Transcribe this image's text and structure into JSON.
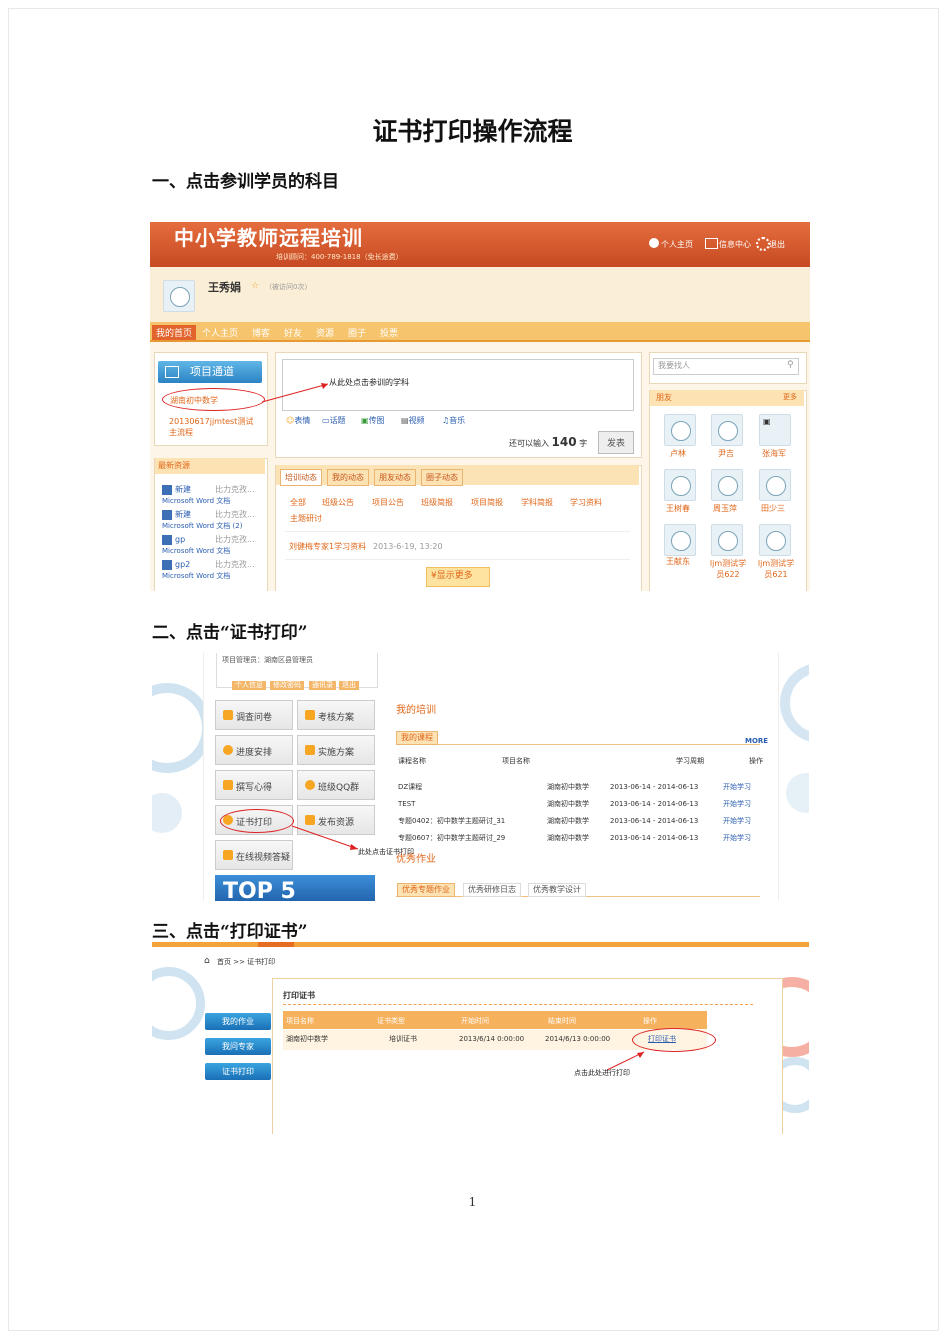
{
  "document": {
    "title": "证书打印操作流程",
    "step1": "一、点击参训学员的科目",
    "step2": "二、点击“证书打印”",
    "step3": "三、点击“打印证书”",
    "page_number": "1"
  },
  "shot1": {
    "banner_title": "中小学教师远程培训",
    "hotline": "培训顾问：400-789-1818（免长途费）",
    "top_links": [
      "个人主页",
      "信息中心",
      "退出"
    ],
    "user_name": "王秀娟",
    "visits": "（被访问0次）",
    "nav": [
      "我的首页",
      "个人主页",
      "博客",
      "好友",
      "资源",
      "圈子",
      "投票"
    ],
    "project_channel": "项目通道",
    "projects": [
      "湖南初中数学",
      "20130617jjmtest测试主流程"
    ],
    "annotation": "从此处点击参训的学科",
    "post_tools": [
      "表情",
      "话题",
      "传图",
      "视频",
      "音乐"
    ],
    "char_limit_prefix": "还可以输入",
    "char_limit_value": "140",
    "char_limit_suffix": "字",
    "publish_button": "发表",
    "new_resources": "最新资源",
    "resources": [
      {
        "name": "新建",
        "author": "比力克孜...",
        "sub": "Microsoft Word 文档"
      },
      {
        "name": "新建",
        "author": "比力克孜...",
        "sub": "Microsoft Word 文档 (2)"
      },
      {
        "name": "gp",
        "author": "比力克孜...",
        "sub": "Microsoft Word 文档"
      },
      {
        "name": "gp2",
        "author": "比力克孜...",
        "sub": "Microsoft Word 文档"
      }
    ],
    "feed_tabs": [
      "培训动态",
      "我的动态",
      "朋友动态",
      "圈子动态"
    ],
    "feed_filters": [
      "全部",
      "班级公告",
      "项目公告",
      "班级简报",
      "项目简报",
      "学科简报",
      "学习资料",
      "主题研讨"
    ],
    "feed_item": "刘健梅专家1学习资料",
    "feed_time": "2013-6-19, 13:20",
    "show_more": "显示更多",
    "search_placeholder": "我要找人",
    "friends_title": "朋友",
    "friends_more": "更多",
    "friends": [
      "卢林",
      "尹吉",
      "张海军",
      "王树春",
      "周玉萍",
      "田少三",
      "王献东",
      "ljm测试学员622",
      "ljm测试学员621"
    ]
  },
  "shot2": {
    "admin_line": "项目管理员：湖南区县管理员",
    "small_tabs": [
      "个人信息",
      "修改密码",
      "通讯录",
      "退出"
    ],
    "menu": [
      "调查问卷",
      "考核方案",
      "进度安排",
      "实施方案",
      "撰写心得",
      "班级QQ群",
      "证书打印",
      "发布资源",
      "在线视频答疑"
    ],
    "banner_text": "TOP 5",
    "annotation": "此处点击证书打印",
    "my_training": "我的培训",
    "my_courses_tab": "我的课程",
    "more": "MORE",
    "headers": [
      "课程名称",
      "项目名称",
      "学习周期",
      "操作"
    ],
    "courses": [
      {
        "name": "DZ课程",
        "project": "湖南初中数学",
        "period": "2013-06-14 - 2014-06-13",
        "op": "开始学习"
      },
      {
        "name": "TEST",
        "project": "湖南初中数学",
        "period": "2013-06-14 - 2014-06-13",
        "op": "开始学习"
      },
      {
        "name": "专题0402：初中数学主题研讨_31",
        "project": "湖南初中数学",
        "period": "2013-06-14 - 2014-06-13",
        "op": "开始学习"
      },
      {
        "name": "专题0607：初中数学主题研讨_29",
        "project": "湖南初中数学",
        "period": "2013-06-14 - 2014-06-13",
        "op": "开始学习"
      }
    ],
    "excellent_title": "优秀作业",
    "excellent_tabs": [
      "优秀专题作业",
      "优秀研修日志",
      "优秀教学设计"
    ]
  },
  "shot3": {
    "breadcrumb": "首页 >> 证书打印",
    "side_buttons": [
      "我的作业",
      "我问专家",
      "证书打印"
    ],
    "panel_title": "打印证书",
    "headers": [
      "项目名称",
      "证书类型",
      "开始时间",
      "结束时间",
      "操作"
    ],
    "row": {
      "project": "湖南初中数学",
      "type": "培训证书",
      "start": "2013/6/14 0:00:00",
      "end": "2014/6/13 0:00:00",
      "op": "打印证书"
    },
    "annotation": "点击此处进行打印"
  }
}
